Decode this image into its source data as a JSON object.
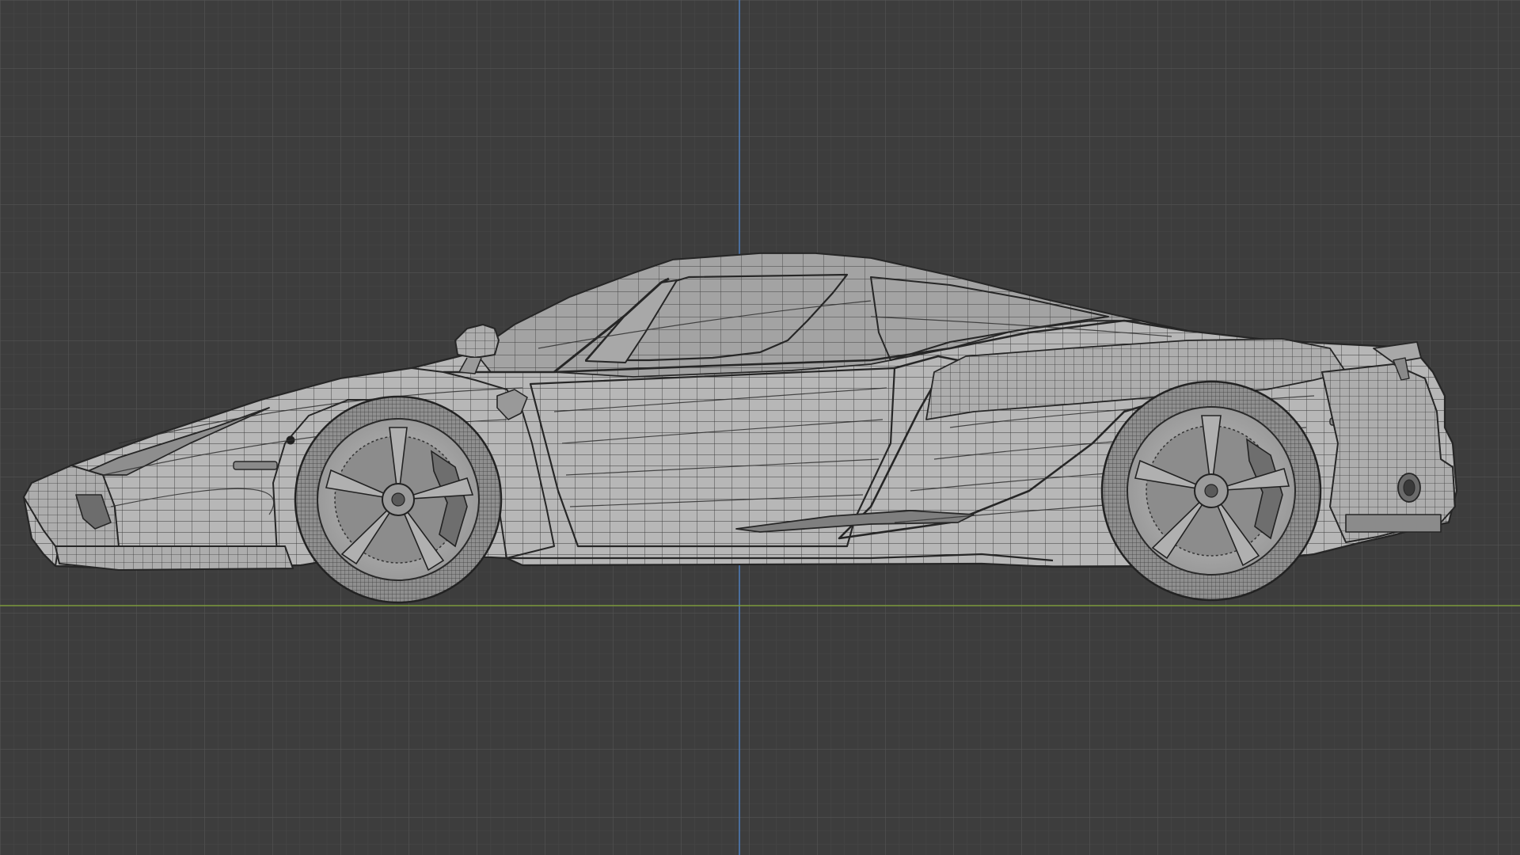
{
  "viewport": {
    "view": "orthographic-side",
    "shading": "wireframe-overlay",
    "colors": {
      "background": "#3d3d3d",
      "grid_minor": "#474747",
      "grid_major": "#535353",
      "axis_x": "#7c9a3c",
      "axis_z": "#4f7fbf",
      "mesh_fill": "#b9b9b9",
      "mesh_shade": "#9c9c9c",
      "mesh_edge": "#2a2a2a",
      "glass": "#9e9e9e"
    },
    "axes": [
      "x-axis-line",
      "z-axis-line"
    ]
  },
  "model": {
    "object": "car-mesh",
    "parts": [
      "body",
      "cabin",
      "side-window",
      "rear-window",
      "side-mirror",
      "front-wheel",
      "rear-wheel",
      "rear-wing",
      "front-splitter",
      "side-intake",
      "door"
    ]
  }
}
